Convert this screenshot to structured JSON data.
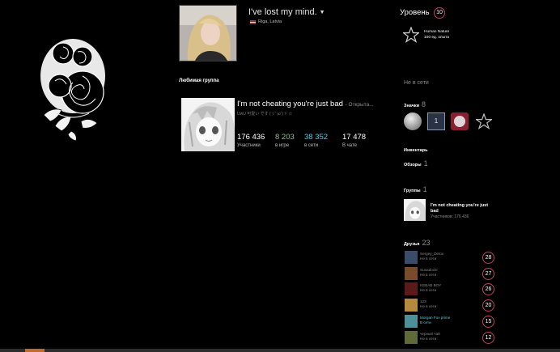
{
  "profile": {
    "persona_name": "I've lost my mind.",
    "location": "Riga, Latvia"
  },
  "favorite_group": {
    "section_title": "Любимая группа",
    "name": "I'm not cheating you're just bad",
    "status": "- Открыта...",
    "subtitle": "UwU 可愛い です (ぅ˘ ω˘)ゞ ☆",
    "stats": [
      {
        "value": "176 436",
        "label": "Участники",
        "color": "#ffffff"
      },
      {
        "value": "8 203",
        "label": "в игре",
        "color": "#8fb98b"
      },
      {
        "value": "38 352",
        "label": "в сети",
        "color": "#57cbde"
      },
      {
        "value": "17 478",
        "label": "В чате",
        "color": "#ffffff"
      }
    ]
  },
  "sidebar": {
    "level_label": "Уровень",
    "level": "10",
    "badge_name": "Human Nature",
    "badge_xp": "100 ед. опыта",
    "status": "Не в сети",
    "badges_label": "Значки",
    "badges_count": "8",
    "badge_one_text": "1",
    "inventory_label": "Инвентарь",
    "reviews_label": "Обзоры",
    "reviews_count": "1",
    "groups_label": "Группы",
    "groups_count": "1",
    "group_name": "I'm not cheating you're just bad",
    "group_members": "Участников: 176 436",
    "friends_label": "Друзья",
    "friends_count": "23",
    "friends": [
      {
        "name": "Sergey_Detox",
        "status": "Не в сети",
        "level": "28",
        "online": false,
        "color": "#3b4c6b"
      },
      {
        "name": "Sunadock!",
        "status": "Не в сети",
        "level": "27",
        "online": false,
        "color": "#7a4a2a"
      },
      {
        "name": "KEBAB BOY",
        "status": "Не в сети",
        "level": "26",
        "online": false,
        "color": "#5a1a1a"
      },
      {
        "name": "123",
        "status": "Не в сети",
        "level": "20",
        "online": false,
        "color": "#b58a3c"
      },
      {
        "name": "Morgan Fox prime",
        "status": "В сети",
        "level": "15",
        "online": true,
        "color": "#4f8f9a"
      },
      {
        "name": "черный чай",
        "status": "Не в сети",
        "level": "12",
        "online": false,
        "color": "#5e6a3a"
      }
    ]
  },
  "colors": {
    "accent_ring": "#c3425b",
    "online": "#57cbde",
    "in_game": "#8fb98b",
    "muted": "#8a8a8a"
  },
  "icons": [
    "rose-skull-artwork",
    "pentagram-icon",
    "dropdown-caret-icon",
    "latvia-flag-icon",
    "steam-badge-icon",
    "coin-badge-icon"
  ]
}
